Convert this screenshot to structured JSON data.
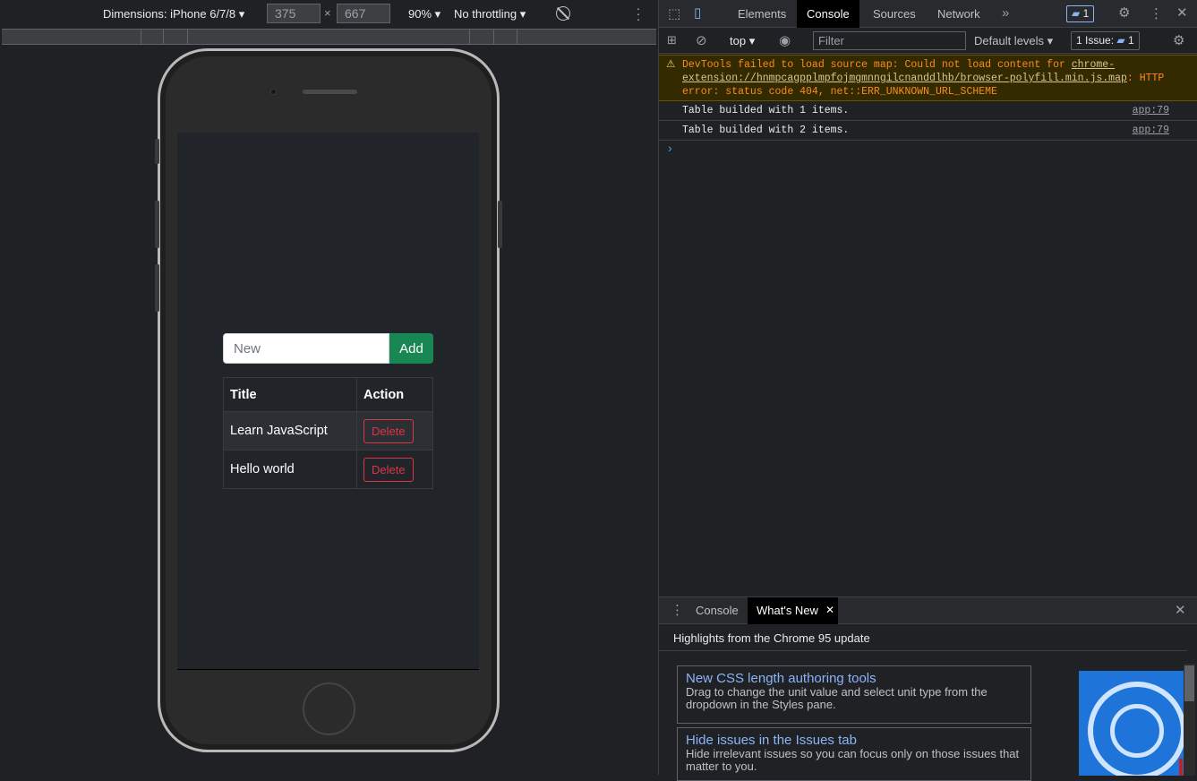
{
  "device_toolbar": {
    "dimensions_label": "Dimensions: iPhone 6/7/8",
    "width": "375",
    "times": "×",
    "height": "667",
    "zoom": "90%",
    "throttling": "No throttling"
  },
  "app": {
    "input_placeholder": "New",
    "add_label": "Add",
    "table_headers": [
      "Title",
      "Action"
    ],
    "rows": [
      {
        "title": "Learn JavaScript",
        "action": "Delete"
      },
      {
        "title": "Hello world",
        "action": "Delete"
      }
    ]
  },
  "devtools": {
    "tabs": [
      "Elements",
      "Console",
      "Sources",
      "Network"
    ],
    "active_tab": "Console",
    "messages_badge": "1",
    "context": "top",
    "filter_placeholder": "Filter",
    "levels": "Default levels",
    "issues": "1 Issue:",
    "issues_count": "1",
    "warning": {
      "text1": "DevTools failed to load source map: Could not load content for ",
      "link": "chrome-extension://hnmpcagpplmpfojmgmnngilcnanddlhb/browser-polyfill.min.js.map",
      "text2": ": HTTP error: status code 404, net::ERR_UNKNOWN_URL_SCHEME"
    },
    "logs": [
      {
        "text": "Table builded with 1 items.",
        "source": "app:79"
      },
      {
        "text": "Table builded with 2 items.",
        "source": "app:79"
      }
    ],
    "drawer": {
      "tabs": [
        "Console",
        "What's New"
      ],
      "active_tab": "What's New",
      "heading": "Highlights from the Chrome 95 update",
      "cards": [
        {
          "title": "New CSS length authoring tools",
          "desc": "Drag to change the unit value and select unit type from the dropdown in the Styles pane."
        },
        {
          "title": "Hide issues in the Issues tab",
          "desc": "Hide irrelevant issues so you can focus only on those issues that matter to you."
        }
      ]
    }
  }
}
